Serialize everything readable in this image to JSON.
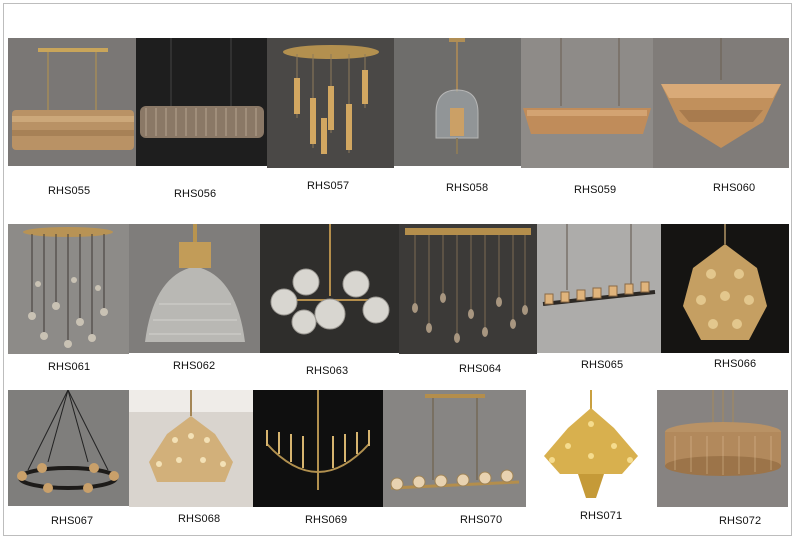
{
  "catalog": {
    "products": [
      {
        "code": "RHS055",
        "kind": "linear crystal chandelier"
      },
      {
        "code": "RHS056",
        "kind": "linear glass rod chandelier"
      },
      {
        "code": "RHS057",
        "kind": "cascade pendant cluster"
      },
      {
        "code": "RHS058",
        "kind": "glass dome pendant"
      },
      {
        "code": "RHS059",
        "kind": "linear amber crystal chandelier"
      },
      {
        "code": "RHS060",
        "kind": "tiered crystal chandelier"
      },
      {
        "code": "RHS061",
        "kind": "crystal drop cluster"
      },
      {
        "code": "RHS062",
        "kind": "ribbed glass dome pendant"
      },
      {
        "code": "RHS063",
        "kind": "crystal globe chandelier"
      },
      {
        "code": "RHS064",
        "kind": "linear crystal drop chandelier"
      },
      {
        "code": "RHS065",
        "kind": "linear candle chandelier"
      },
      {
        "code": "RHS066",
        "kind": "crystal tier chandelier"
      },
      {
        "code": "RHS067",
        "kind": "round arm chandelier"
      },
      {
        "code": "RHS068",
        "kind": "grand tiered chandelier"
      },
      {
        "code": "RHS069",
        "kind": "candle ring chandelier"
      },
      {
        "code": "RHS070",
        "kind": "linear crystal cup chandelier"
      },
      {
        "code": "RHS071",
        "kind": "baroque gold chandelier"
      },
      {
        "code": "RHS072",
        "kind": "drum crystal chandelier"
      }
    ]
  }
}
